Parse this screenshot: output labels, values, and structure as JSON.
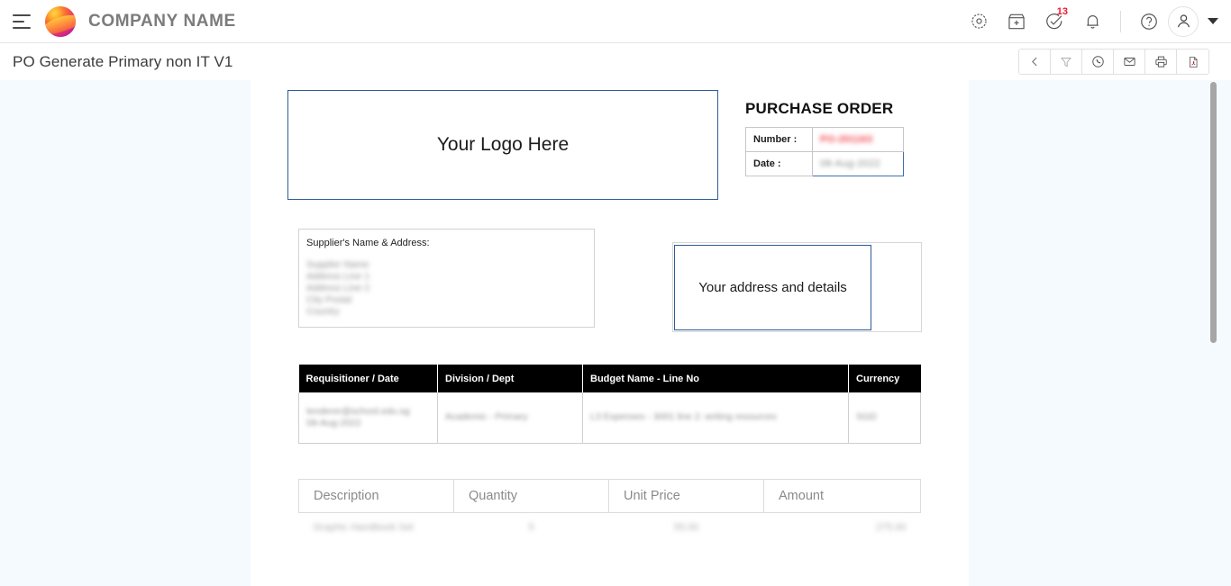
{
  "appbar": {
    "menu_icon": "hamburger-menu-icon",
    "brand_logo_icon": "company-logo-icon",
    "brand_name": "COMPANY NAME",
    "icons": [
      {
        "name": "settings-gear-icon",
        "badge": ""
      },
      {
        "name": "store-icon",
        "badge": ""
      },
      {
        "name": "task-check-icon",
        "badge": "13"
      },
      {
        "name": "notification-bell-icon",
        "badge": ""
      },
      {
        "name": "help-circle-icon",
        "badge": ""
      }
    ],
    "avatar_icon": "user-avatar-icon",
    "caret_icon": "chevron-down-icon"
  },
  "subheader": {
    "title": "PO Generate Primary non IT V1",
    "toolbar": [
      {
        "name": "back-button",
        "icon": "chevron-left-icon"
      },
      {
        "name": "filter-button",
        "icon": "filter-funnel-icon"
      },
      {
        "name": "whatsapp-button",
        "icon": "whatsapp-icon"
      },
      {
        "name": "email-button",
        "icon": "envelope-icon"
      },
      {
        "name": "print-button",
        "icon": "printer-icon"
      },
      {
        "name": "pdf-button",
        "icon": "pdf-file-icon"
      }
    ]
  },
  "document": {
    "logo_placeholder": "Your Logo Here",
    "po_title": "PURCHASE ORDER",
    "po_fields": [
      {
        "label": "Number :",
        "value": "PO-201163",
        "style": "red-redacted"
      },
      {
        "label": "Date :",
        "value": "08-Aug-2022",
        "style": "gray-redacted"
      }
    ],
    "supplier": {
      "label": "Supplier's Name & Address:",
      "address": "Supplier Name\nAddress Line 1\nAddress Line 2\nCity Postal\nCountry"
    },
    "your_address_placeholder": "Your address and\ndetails",
    "requisition_table": {
      "headers": [
        "Requisitioner / Date",
        "Division / Dept",
        "Budget Name - Line No",
        "Currency"
      ],
      "rows": [
        {
          "requisitioner": "tenderer@school.edu.sg\n08-Aug-2022",
          "division": "Academic - Primary",
          "budget": "L3 Expenses - 3001 line 2: writing resources",
          "currency": "SGD"
        }
      ]
    },
    "items_table": {
      "headers": [
        "Description",
        "Quantity",
        "Unit Price",
        "Amount"
      ],
      "rows": [
        {
          "description": "Graphic Handbook Set",
          "quantity": "5",
          "unit_price": "55.00",
          "amount": "275.00"
        }
      ]
    }
  },
  "scrollbar": {
    "name": "vertical-scrollbar"
  },
  "colors": {
    "accent_blue": "#2e5c96",
    "workspace_bg": "#f4fafd",
    "badge_red": "#e8192c",
    "header_black": "#000000"
  }
}
